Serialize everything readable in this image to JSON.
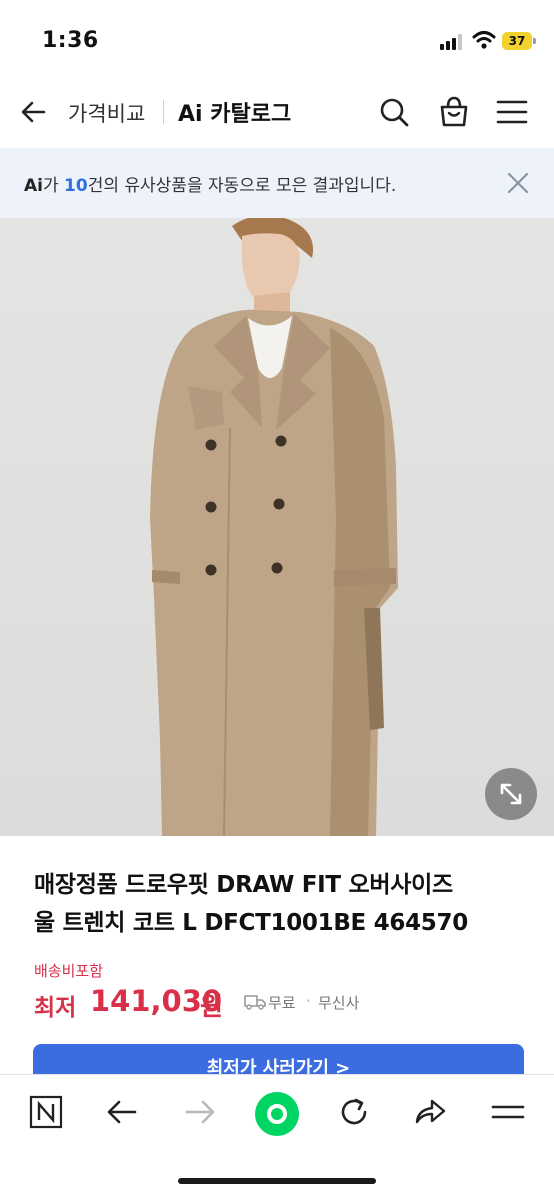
{
  "status_bar": {
    "time": "1:36",
    "battery": "37"
  },
  "nav": {
    "back_icon": "arrow-left-icon",
    "compare_label": "가격비교",
    "catalog_label": "Ai 카탈로그",
    "icons": [
      "search-icon",
      "shopping-bag-icon",
      "menu-icon"
    ]
  },
  "banner": {
    "ai_logo": "Ai",
    "text_before": "가 ",
    "count": "10",
    "text_after": "건의 유사상품을 자동으로 모은 결과입니다.",
    "close_icon": "close-icon",
    "accent": "#2f6fe0"
  },
  "product": {
    "image_icon": "expand-icon",
    "title_line1": "매장정품 드로우핏 DRAW FIT 오버사이즈",
    "title_line2": "울 트렌치 코트 L DFCT1001BE 464570",
    "shipping_included": "배송비포함",
    "price_prefix": "최저",
    "price_value": "141,030",
    "price_unit": "원",
    "shipping_fee": "무료",
    "separator": "·",
    "store": "무신사",
    "price_color": "#d9304a"
  },
  "buy_button": {
    "label": "최저가 사러가기 >",
    "color": "#3b6de0"
  },
  "browser_toolbar": {
    "icons": [
      "naver-n-icon",
      "back-arrow-icon",
      "forward-arrow-icon",
      "home-green-icon",
      "refresh-icon",
      "share-icon",
      "menu-lines-icon"
    ],
    "accent": "#00d564"
  }
}
